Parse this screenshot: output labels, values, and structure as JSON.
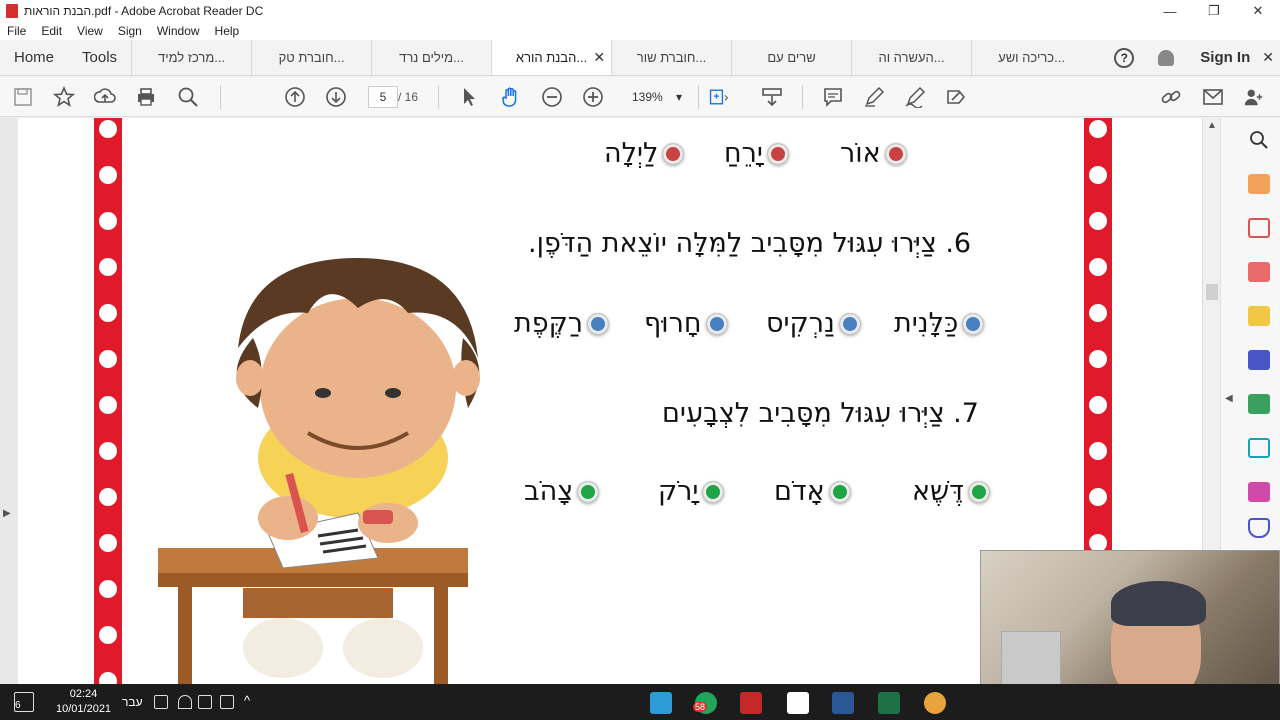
{
  "window": {
    "title": "הבנת הוראות.pdf - Adobe Acrobat Reader DC",
    "controls": [
      "—",
      "❐",
      "✕"
    ]
  },
  "menu": [
    "File",
    "Edit",
    "View",
    "Sign",
    "Window",
    "Help"
  ],
  "tabs": {
    "home": "Home",
    "tools": "Tools",
    "documents": [
      {
        "label": "מרכז למיד...",
        "active": false
      },
      {
        "label": "חוברת טק...",
        "active": false
      },
      {
        "label": "מילים נרד...",
        "active": false
      },
      {
        "label": "הבנת הורא...",
        "active": true
      },
      {
        "label": "חוברת שור...",
        "active": false
      },
      {
        "label": "שרים עם",
        "active": false
      },
      {
        "label": "העשרה וה...",
        "active": false
      },
      {
        "label": "כריכה ושע...",
        "active": false
      }
    ],
    "help": "?",
    "sign_in": "Sign In"
  },
  "toolbar": {
    "page_current": "5",
    "page_total": "/ 16",
    "zoom": "139%",
    "icons": [
      "save-icon",
      "bookmark-star-icon",
      "upload-icon",
      "print-icon",
      "search-zoom-icon",
      "page-up-icon",
      "page-down-icon",
      "select-cursor-icon",
      "hand-tool-icon",
      "zoom-out-icon",
      "zoom-in-icon",
      "fit-page-icon",
      "scroll-mode-icon",
      "comment-icon",
      "highlight-pen-icon",
      "sign-icon",
      "fill-sign-icon",
      "share-link-icon",
      "email-icon",
      "add-user-icon"
    ]
  },
  "document": {
    "row_top": {
      "options": [
        "אוֹר",
        "יָרֵחַ",
        "לַיְלָה"
      ],
      "bullet_color": "#c94343"
    },
    "question6": {
      "text": "6. צַיְּרוּ עִגּוּל מִסָּבִיב לַמִּלָּה יוֹצֵאת הַדֹּפֶן.",
      "options": [
        "כַּלָּנִית",
        "נַרְקִיס",
        "חָרוּף",
        "רַקֶּפֶת"
      ],
      "bullet_color": "#4a7fc1"
    },
    "question7": {
      "text": "7. צַיְּרוּ עִגּוּל מִסָּבִיב לִצְבָעִים",
      "options": [
        "דֶּשֶׁא",
        "אָדֹם",
        "יָרֹק",
        "צָהֹב"
      ],
      "bullet_color": "#1fa545"
    },
    "border_color": "#e0192b"
  },
  "taskbar": {
    "time": "02:24",
    "date": "10/01/2021",
    "language": "עבר",
    "notification_count": "6",
    "badge": "58"
  }
}
